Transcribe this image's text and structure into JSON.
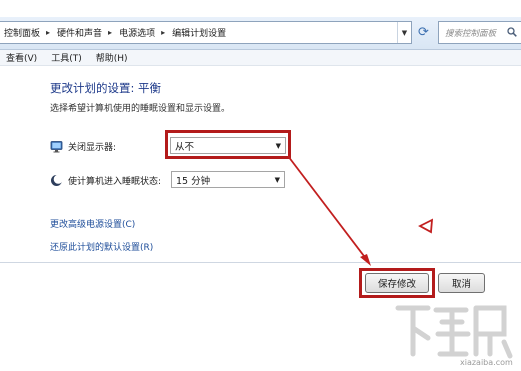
{
  "breadcrumbs": [
    "控制面板",
    "硬件和声音",
    "电源选项",
    "编辑计划设置"
  ],
  "search": {
    "placeholder": "搜索控制面板"
  },
  "menu": [
    "查看(V)",
    "工具(T)",
    "帮助(H)"
  ],
  "page": {
    "title": "更改计划的设置: 平衡",
    "subtitle": "选择希望计算机使用的睡眠设置和显示设置。"
  },
  "settings": [
    {
      "label": "关闭显示器:",
      "value": "从不",
      "icon": "monitor-icon"
    },
    {
      "label": "使计算机进入睡眠状态:",
      "value": "15 分钟",
      "icon": "moon-icon"
    }
  ],
  "links": {
    "advanced": "更改高级电源设置(C)",
    "restore": "还原此计划的默认设置(R)"
  },
  "buttons": {
    "save": "保存修改",
    "cancel": "取消"
  },
  "watermark": {
    "site": "xiazaiba.com"
  },
  "colors": {
    "highlight": "#b31b1b",
    "link": "#1f4e9a",
    "title": "#1e3a8a"
  }
}
